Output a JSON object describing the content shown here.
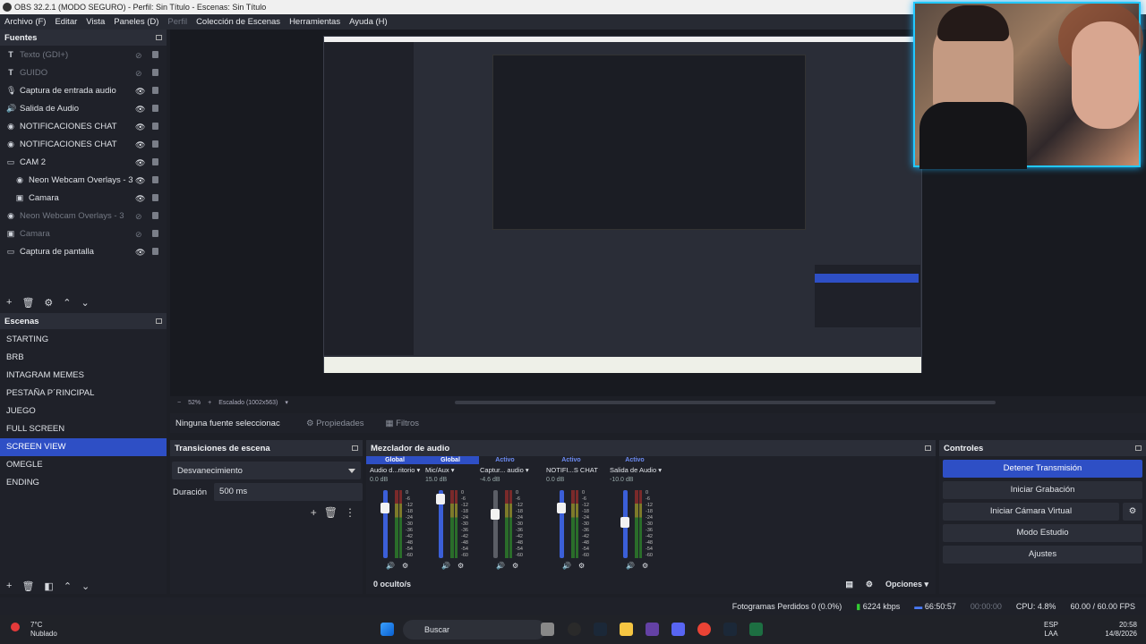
{
  "window": {
    "title": "OBS 32.2.1 (MODO SEGURO) - Perfil: Sin Título - Escenas: Sin Título"
  },
  "menu": [
    "Archivo (F)",
    "Editar",
    "Vista",
    "Paneles (D)",
    "Perfil",
    "Colección de Escenas",
    "Herramientas",
    "Ayuda (H)"
  ],
  "sources": {
    "title": "Fuentes",
    "items": [
      {
        "label": "Texto (GDI+)",
        "icon": "text-icon",
        "dim": true
      },
      {
        "label": "GUIDO",
        "icon": "text-icon",
        "dim": true
      },
      {
        "label": "Captura de entrada audio",
        "icon": "microphone-icon",
        "dim": false
      },
      {
        "label": "Salida de Audio",
        "icon": "speaker-icon",
        "dim": false
      },
      {
        "label": "NOTIFICACIONES CHAT",
        "icon": "globe-icon",
        "dim": false
      },
      {
        "label": "NOTIFICACIONES CHAT",
        "icon": "globe-icon",
        "dim": false
      },
      {
        "label": "CAM 2",
        "icon": "folder-icon",
        "dim": false
      },
      {
        "label": "Neon Webcam Overlays - 3",
        "icon": "globe-icon",
        "dim": false
      },
      {
        "label": "Camara",
        "icon": "camera-icon",
        "dim": false
      },
      {
        "label": "Neon Webcam Overlays - 3",
        "icon": "globe-icon",
        "dim": true
      },
      {
        "label": "Camara",
        "icon": "camera-icon",
        "dim": true
      },
      {
        "label": "Captura de pantalla",
        "icon": "monitor-icon",
        "dim": false
      }
    ]
  },
  "scenes": {
    "title": "Escenas",
    "items": [
      "STARTING",
      "BRB",
      "INTAGRAM MEMES",
      "PESTAÑA P´RINCIPAL",
      "JUEGO",
      "FULL SCREEN",
      "SCREEN VIEW",
      "OMEGLE",
      "ENDING"
    ],
    "active": "SCREEN VIEW"
  },
  "preview": {
    "zoom": "52%",
    "scale": "Escalado (1002x563)"
  },
  "props": {
    "none": "Ninguna fuente seleccionac",
    "properties": "Propiedades",
    "filters": "Filtros"
  },
  "transitions": {
    "title": "Transiciones de escena",
    "type": "Desvanecimiento",
    "duration_label": "Duración",
    "duration": "500 ms"
  },
  "mixer": {
    "title": "Mezclador de audio",
    "channels": [
      {
        "tag": "Global",
        "name": "Audio d...ritorio",
        "db": "0.0 dB",
        "level": 0.82
      },
      {
        "tag": "Global",
        "name": "Mic/Aux",
        "db": "15.0 dB",
        "level": 0.95
      },
      {
        "tag": "Activo",
        "name": "Captur... audio",
        "db": "-4.6 dB",
        "level": 0.72
      },
      {
        "tag": "Activo",
        "name": "NOTIFI...S CHAT",
        "db": "0.0 dB",
        "level": 0.82
      },
      {
        "tag": "Activo",
        "name": "Salida de Audio",
        "db": "-10.0 dB",
        "level": 0.6
      }
    ],
    "hidden": "0 oculto/s",
    "options": "Opciones",
    "scale": [
      "0",
      "-6",
      "-12",
      "-18",
      "-24",
      "-30",
      "-36",
      "-42",
      "-48",
      "-54",
      "-60"
    ]
  },
  "controls": {
    "title": "Controles",
    "buttons": [
      "Detener Transmisión",
      "Iniciar Grabación",
      "Iniciar Cámara Virtual",
      "Modo Estudio",
      "Ajustes"
    ]
  },
  "status": {
    "dropped": "Fotogramas Perdidos 0 (0.0%)",
    "kbps": "6224 kbps",
    "stream_time": "66:50:57",
    "rec_time": "00:00:00",
    "cpu": "CPU: 4.8%",
    "fps": "60.00 / 60.00 FPS"
  },
  "taskbar": {
    "temp": "7°C",
    "weather": "Nublado",
    "search": "Buscar",
    "lang1": "ESP",
    "lang2": "LAA",
    "time": "20:58",
    "date": "14/8/2026"
  }
}
